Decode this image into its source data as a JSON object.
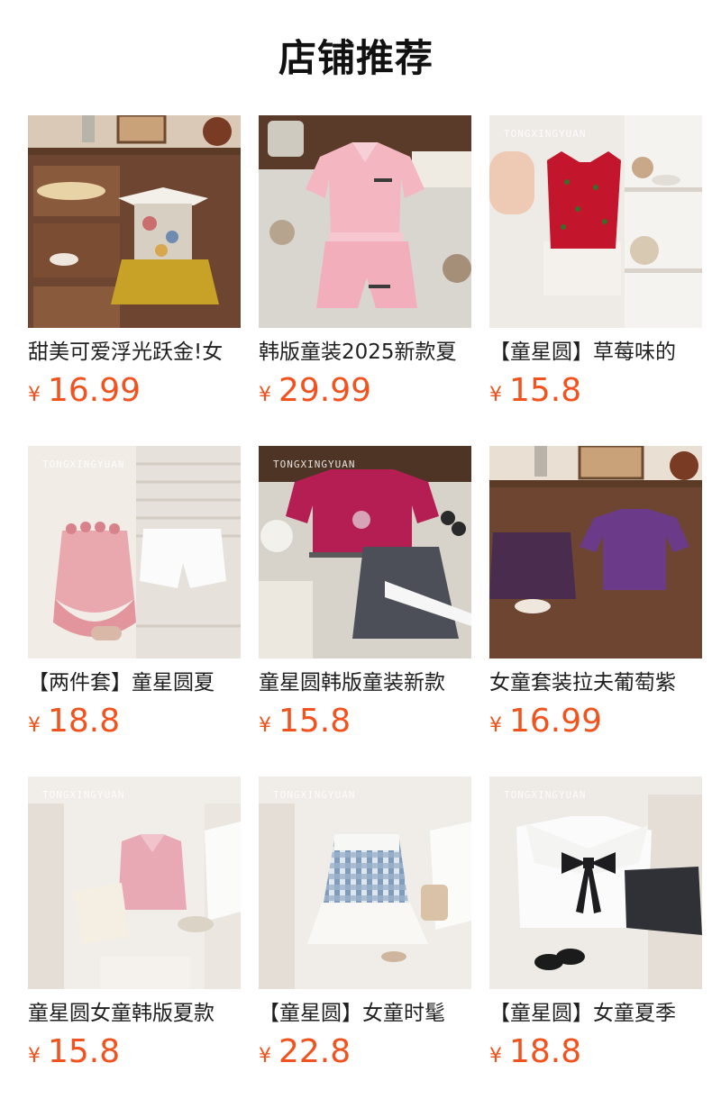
{
  "page_title": "店铺推荐",
  "currency_symbol": "¥",
  "watermark": "TONGXINGYUAN",
  "products": [
    {
      "name": "甜美可爱浮光跃金!女",
      "price": "16.99"
    },
    {
      "name": "韩版童装2025新款夏",
      "price": "29.99"
    },
    {
      "name": "【童星圆】草莓味的",
      "price": "15.8"
    },
    {
      "name": "【两件套】童星圆夏",
      "price": "18.8"
    },
    {
      "name": "童星圆韩版童装新款",
      "price": "15.8"
    },
    {
      "name": "女童套装拉夫葡萄紫",
      "price": "16.99"
    },
    {
      "name": "童星圆女童韩版夏款",
      "price": "15.8"
    },
    {
      "name": "【童星圆】女童时髦",
      "price": "22.8"
    },
    {
      "name": "【童星圆】女童夏季",
      "price": "18.8"
    }
  ],
  "colors": {
    "price": "#f2521e",
    "title": "#111111",
    "product_name": "#1f1f1f"
  }
}
